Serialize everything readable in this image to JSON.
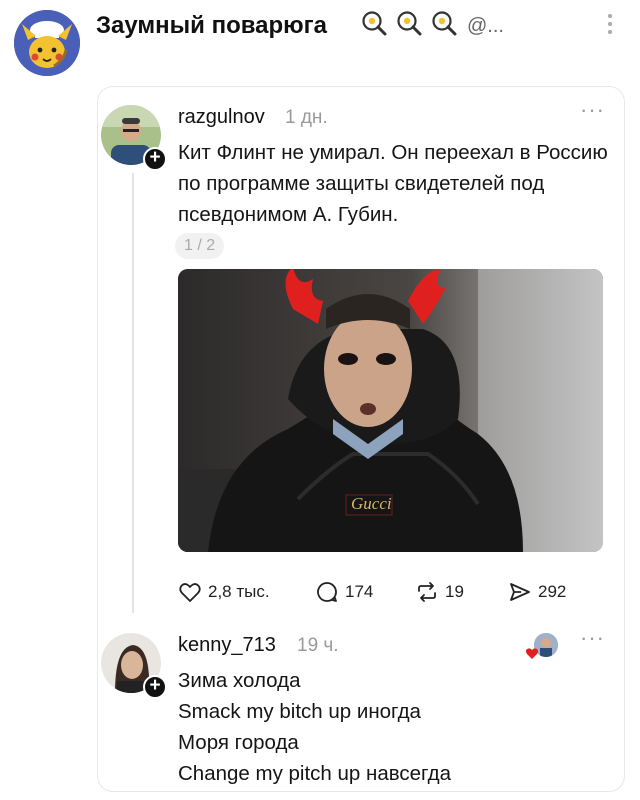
{
  "header": {
    "channel_name": "Заумный поварюга",
    "handle": "@...",
    "icons": [
      "frying-pan-icon",
      "frying-pan-icon",
      "frying-pan-icon",
      "kebab-menu-icon"
    ]
  },
  "post": {
    "username": "razgulnov",
    "time": "1 дн.",
    "text": "Кит Флинт не умирал. Он переехал в Россию по программе защиты свидетелей под псевдонимом А. Губин.",
    "page_indicator": "1 / 2",
    "likes": "2,8 тыс.",
    "comments": "174",
    "reposts": "19",
    "shares": "292",
    "image_text": "Gucci"
  },
  "reply": {
    "username": "kenny_713",
    "time": "19 ч.",
    "lines": [
      "Зима холода",
      "Smack my bitch up иногда",
      "Моря города",
      "Change my pitch up навсегда"
    ]
  },
  "colors": {
    "text": "#111111",
    "muted": "#9a9a9a",
    "card_border": "#e8e8e8",
    "hair_red": "#e0201f",
    "channel_avatar_bg": "#4a5fb8"
  }
}
